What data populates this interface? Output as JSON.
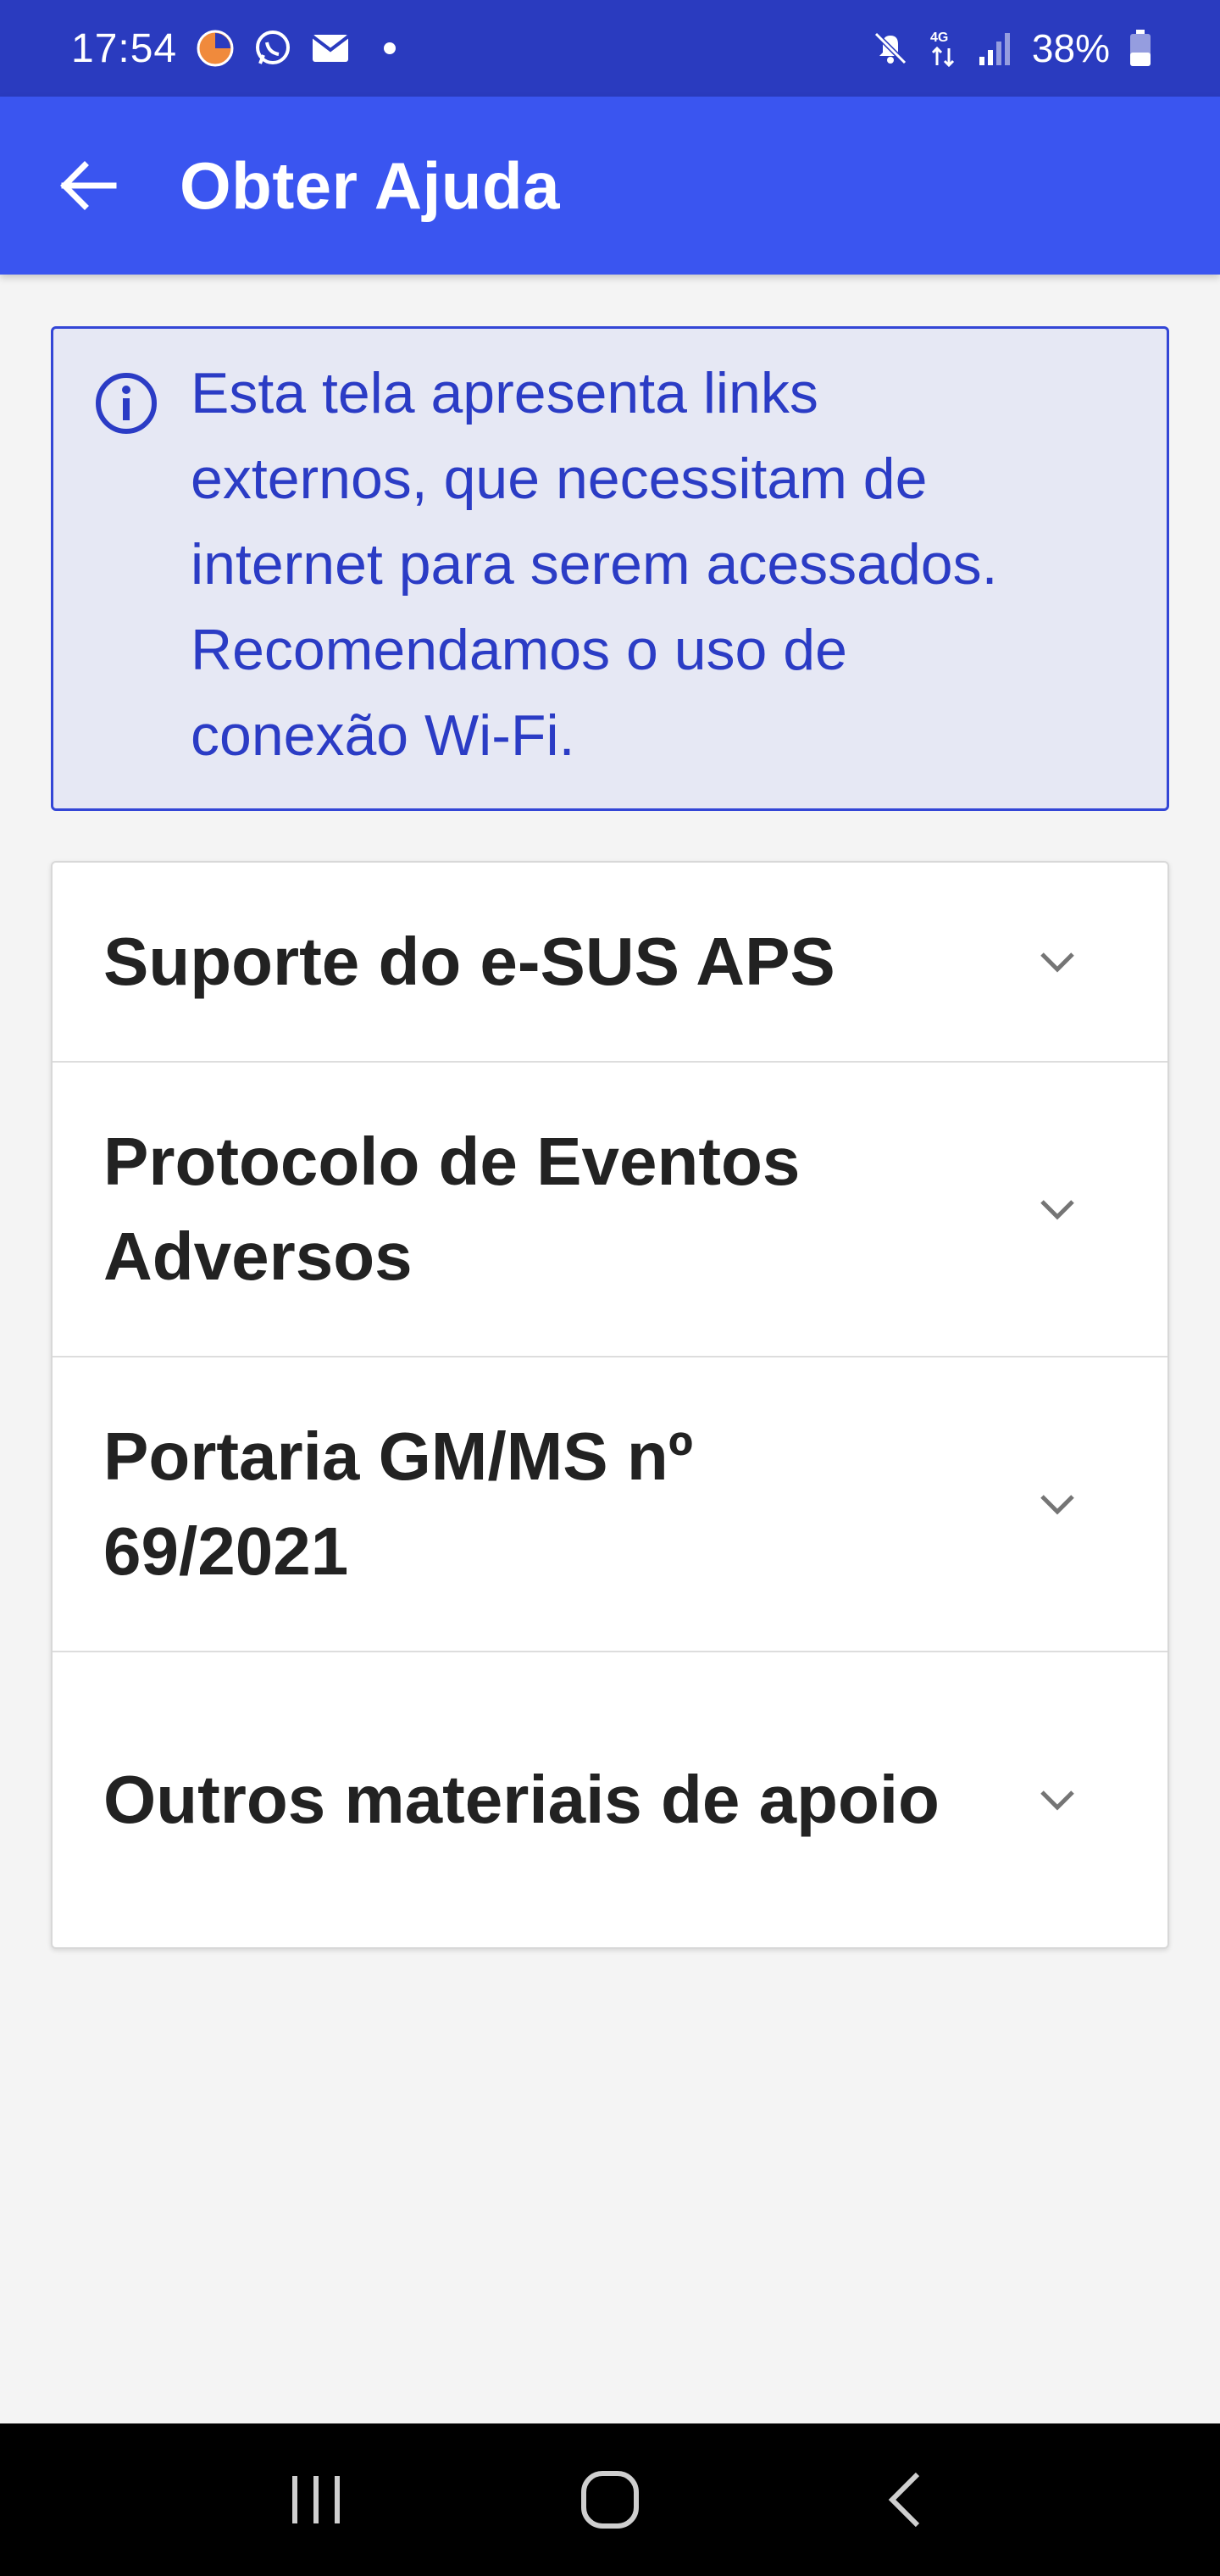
{
  "status_bar": {
    "time": "17:54",
    "battery": "38%",
    "network": "4G",
    "icons": [
      "clock-app-icon",
      "whatsapp-icon",
      "mail-icon",
      "notification-dot",
      "mute-icon",
      "data-4g-icon",
      "signal-icon",
      "battery-icon"
    ]
  },
  "app_bar": {
    "title": "Obter Ajuda",
    "back_icon": "arrow-left-icon"
  },
  "info": {
    "icon": "info-icon",
    "line1": "Esta tela apresenta links",
    "line2": "externos, que necessitam de",
    "line3": "internet para serem acessados.",
    "line4": "Recomendamos o uso de",
    "line5": "conexão Wi-Fi."
  },
  "accordion": {
    "items": [
      {
        "label": "Suporte do e-SUS APS"
      },
      {
        "label": "Protocolo de Eventos Adversos"
      },
      {
        "label": "Portaria GM/MS nº 69/2021"
      },
      {
        "label": "Outros materiais de apoio"
      }
    ]
  },
  "nav_bar": {
    "icons": [
      "recent-apps-icon",
      "home-icon",
      "back-icon"
    ]
  },
  "colors": {
    "status_bar": "#2a3bbf",
    "app_bar": "#3a55f0",
    "info_text": "#2b3cc5",
    "info_bg": "#e6e8f4"
  }
}
